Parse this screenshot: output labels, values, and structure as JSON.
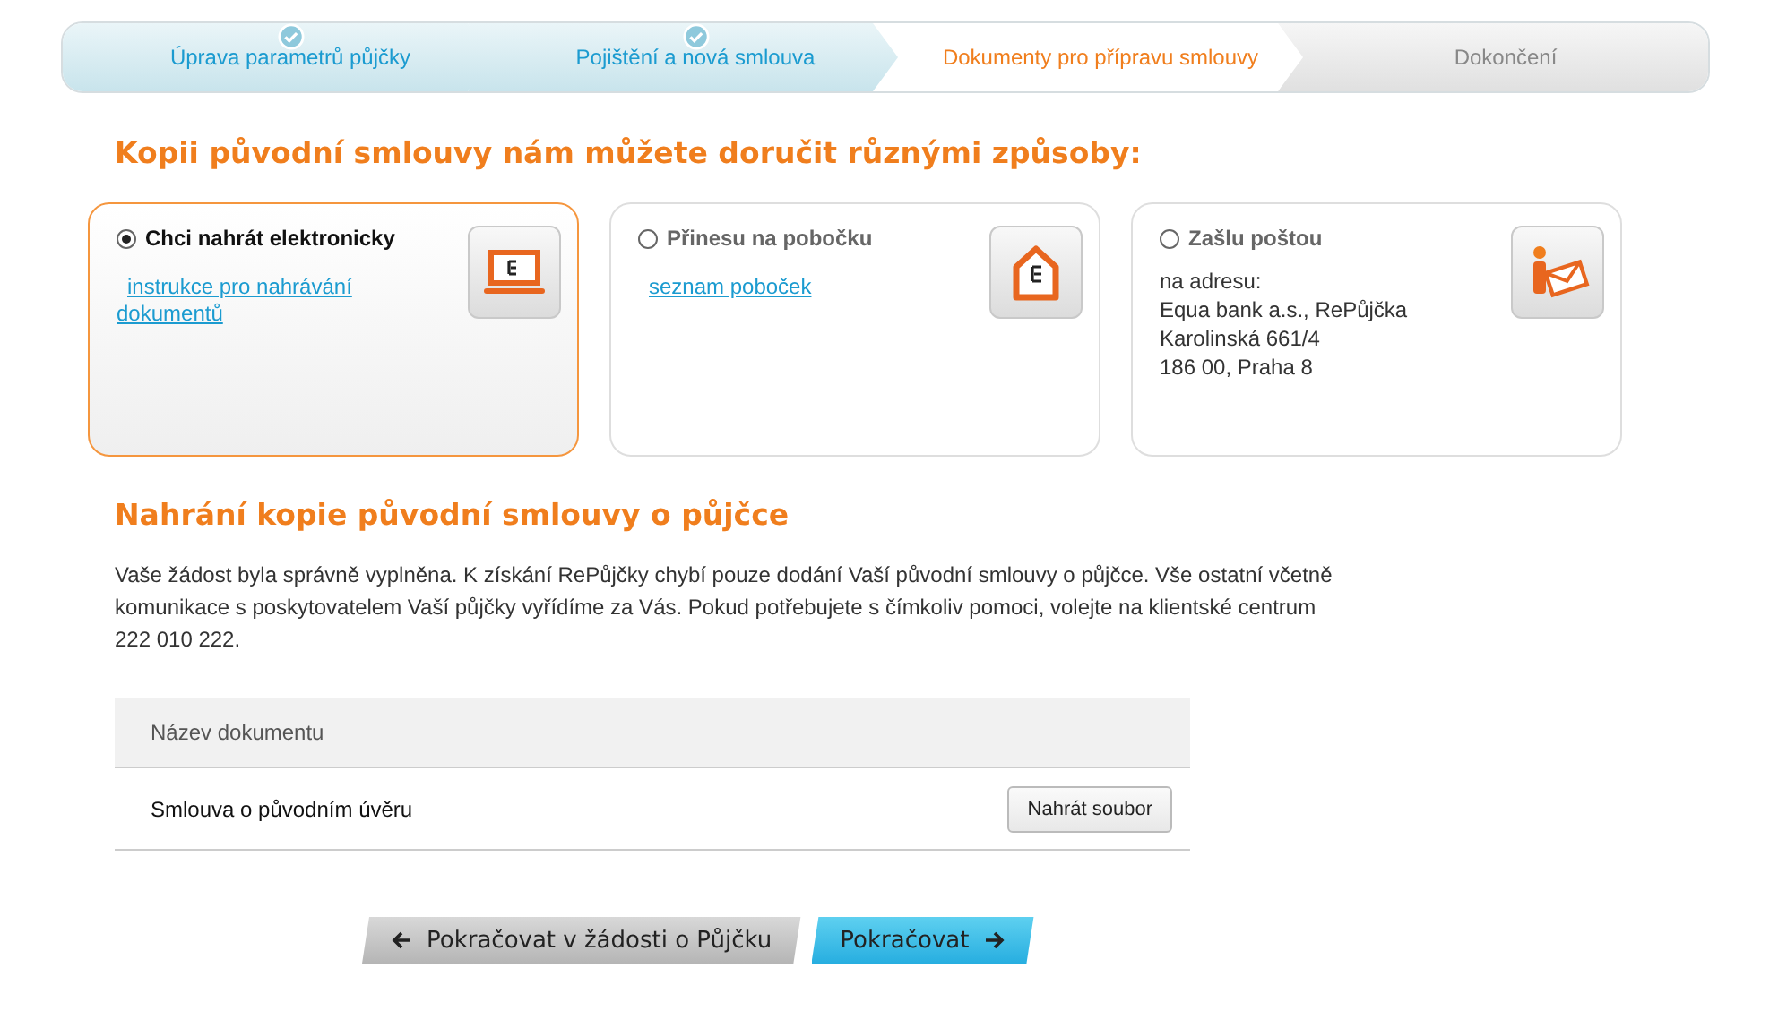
{
  "steps": [
    {
      "label": "Úprava parametrů půjčky",
      "done": true,
      "selected": false
    },
    {
      "label": "Pojištění a nová smlouva",
      "done": true,
      "selected": false
    },
    {
      "label": "Dokumenty pro přípravu smlouvy",
      "done": false,
      "selected": true
    },
    {
      "label": "Dokončení",
      "done": false,
      "selected": false
    }
  ],
  "delivery_heading": "Kopii původní smlouvy nám můžete doručit různými způsoby:",
  "options": [
    {
      "label": "Chci nahrát elektronicky",
      "selected": true,
      "kind": "laptop",
      "link": "instrukce pro nahrávání dokumentů"
    },
    {
      "label": "Přinesu na pobočku",
      "selected": false,
      "kind": "house",
      "link": "seznam poboček"
    },
    {
      "label": "Zašlu poštou",
      "selected": false,
      "kind": "mail",
      "address": [
        "na adresu:",
        "Equa bank a.s., RePůjčka",
        "Karolinská 661/4",
        "186 00, Praha 8"
      ]
    }
  ],
  "upload_heading": "Nahrání kopie původní smlouvy o půjčce",
  "intro": "Vaše žádost byla správně vyplněna. K získání RePůjčky chybí pouze dodání Vaší původní smlouvy o půjčce. Vše ostatní včetně komunikace s poskytovatelem Vaší půjčky vyřídíme za Vás. Pokud potřebujete s čímkoliv pomoci, volejte na klientské centrum 222 010 222.",
  "table": {
    "columns": [
      "Název dokumentu"
    ],
    "rows": [
      {
        "name": "Smlouva o původním úvěru",
        "action": "Nahrát soubor"
      }
    ]
  },
  "buttons": [
    {
      "label": "Pokračovat v žádosti o Půjčku",
      "kind": "back"
    },
    {
      "label": "Pokračovat",
      "kind": "next"
    }
  ]
}
